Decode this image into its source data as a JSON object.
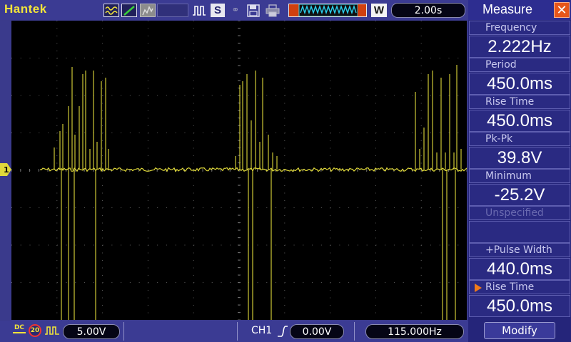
{
  "header": {
    "brand": "Hantek",
    "timebase": "2.00s",
    "save_format_letter": "S",
    "window_mode_letter": "W"
  },
  "icons": {
    "waveform": "waveform-icon",
    "edge": "edge-icon",
    "pulse": "pulse-icon",
    "link": "link-icon",
    "save": "floppy-icon",
    "print": "print-icon"
  },
  "channel": {
    "marker": "1",
    "coupling": "DC",
    "bandwidth_limit": "20",
    "volts_div": "5.00V",
    "trigger_channel": "CH1",
    "trigger_level": "0.00V",
    "frequency": "115.000Hz",
    "color": "#e0d93a"
  },
  "panel": {
    "title": "Measure",
    "close_symbol": "✕",
    "measurements": [
      {
        "label": "Frequency",
        "value": "2.222Hz"
      },
      {
        "label": "Period",
        "value": "450.0ms"
      },
      {
        "label": "Rise Time",
        "value": "450.0ms"
      },
      {
        "label": "Pk-Pk",
        "value": "39.8V"
      },
      {
        "label": "Minimum",
        "value": "-25.2V"
      },
      {
        "label": "Unspecified",
        "value": ""
      },
      {
        "label": "+Pulse Width",
        "value": "440.0ms"
      },
      {
        "label": "Rise Time",
        "value": "450.0ms"
      }
    ],
    "modify_label": "Modify"
  }
}
